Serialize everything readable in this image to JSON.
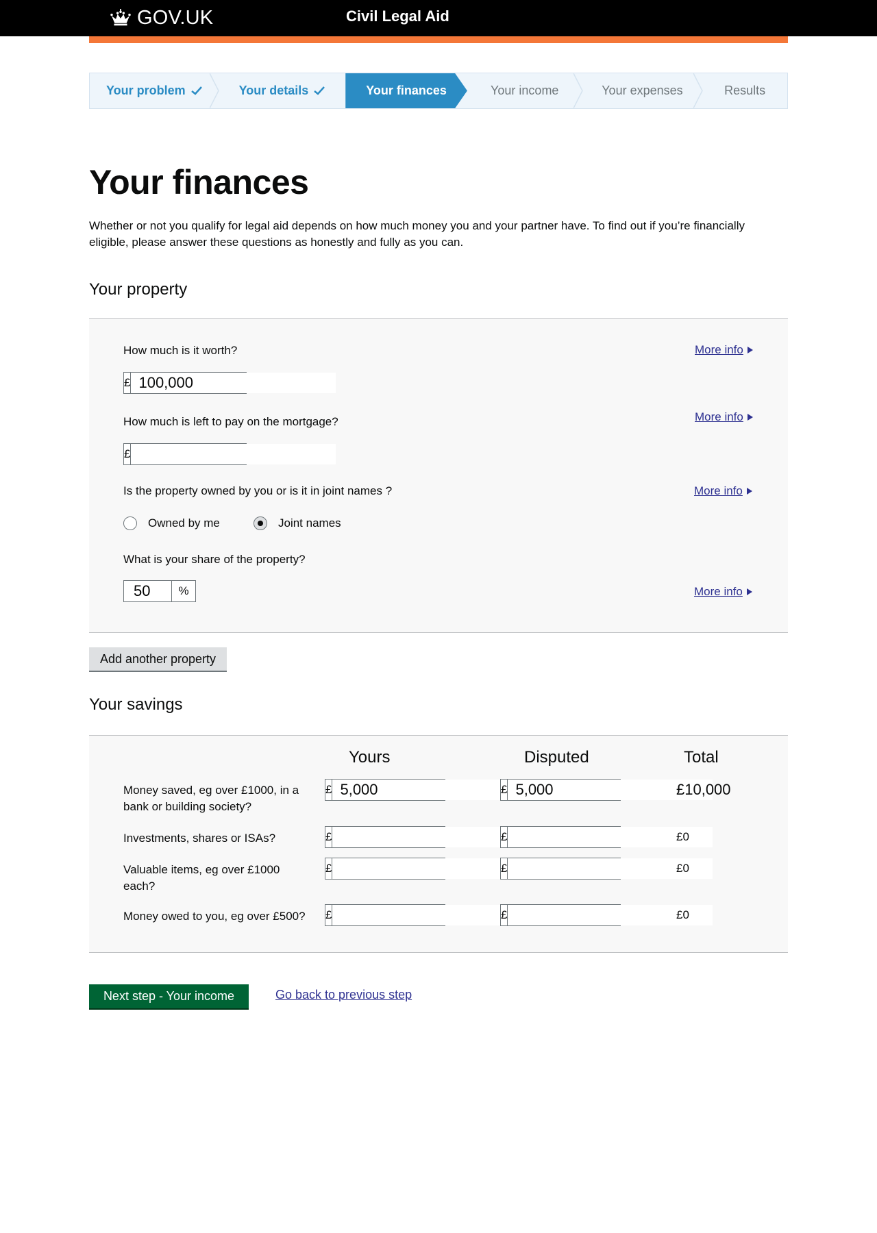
{
  "header": {
    "logo_text": "GOV.UK",
    "service_name": "Civil Legal Aid"
  },
  "steps": [
    {
      "label": "Your problem",
      "state": "done"
    },
    {
      "label": "Your details",
      "state": "done"
    },
    {
      "label": "Your finances",
      "state": "current"
    },
    {
      "label": "Your income",
      "state": "upcoming"
    },
    {
      "label": "Your expenses",
      "state": "upcoming"
    },
    {
      "label": "Results",
      "state": "upcoming"
    }
  ],
  "page": {
    "title": "Your finances",
    "intro": "Whether or not you qualify for legal aid depends on how much money you and your partner have. To find out if you’re financially eligible, please answer these questions as honestly and fully as you can."
  },
  "property": {
    "heading": "Your property",
    "more_info": "More info",
    "currency": "£",
    "worth_question": "How much is it worth?",
    "worth_value": "100,000",
    "mortgage_question": "How much is left to pay on the mortgage?",
    "mortgage_value": "",
    "ownership_question": "Is the property owned by you or is it in joint names ?",
    "ownership_options": [
      {
        "label": "Owned by me",
        "selected": false
      },
      {
        "label": "Joint names",
        "selected": true
      }
    ],
    "share_question": "What is your share of the property?",
    "share_value": "50",
    "share_unit": "%",
    "add_button": "Add another property"
  },
  "savings": {
    "heading": "Your savings",
    "columns": {
      "yours": "Yours",
      "disputed": "Disputed",
      "total": "Total"
    },
    "currency": "£",
    "rows": [
      {
        "label": "Money saved, eg over £1000, in a bank or building society?",
        "yours": "5,000",
        "disputed": "5,000",
        "total": "£10,000"
      },
      {
        "label": "Investments, shares or ISAs?",
        "yours": "",
        "disputed": "",
        "total": "£0"
      },
      {
        "label": "Valuable items, eg over £1000 each?",
        "yours": "",
        "disputed": "",
        "total": "£0"
      },
      {
        "label": "Money owed to you, eg over £500?",
        "yours": "",
        "disputed": "",
        "total": "£0"
      }
    ]
  },
  "actions": {
    "next": "Next step - Your income",
    "back": "Go back to previous step"
  },
  "colors": {
    "header_bg": "#000000",
    "orange_bar": "#f47738",
    "step_blue": "#2b8cc4",
    "link": "#2e3191",
    "green_button": "#006435"
  }
}
